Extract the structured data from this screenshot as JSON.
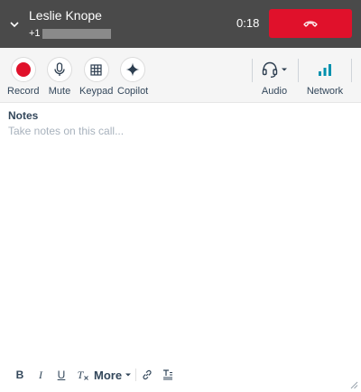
{
  "call": {
    "contact_name": "Leslie Knope",
    "number_prefix": "+1",
    "timer": "0:18"
  },
  "toolbar": {
    "record_label": "Record",
    "mute_label": "Mute",
    "keypad_label": "Keypad",
    "copilot_label": "Copilot",
    "audio_label": "Audio",
    "network_label": "Network"
  },
  "notes": {
    "title": "Notes",
    "placeholder": "Take notes on this call..."
  },
  "editor": {
    "bold": "B",
    "italic": "I",
    "underline": "U",
    "clear": "T",
    "more_label": "More"
  },
  "colors": {
    "header_bg": "#4a4a4a",
    "hangup": "#e0112b",
    "record_dot": "#e0112b",
    "network_bars": "#0091ae"
  }
}
